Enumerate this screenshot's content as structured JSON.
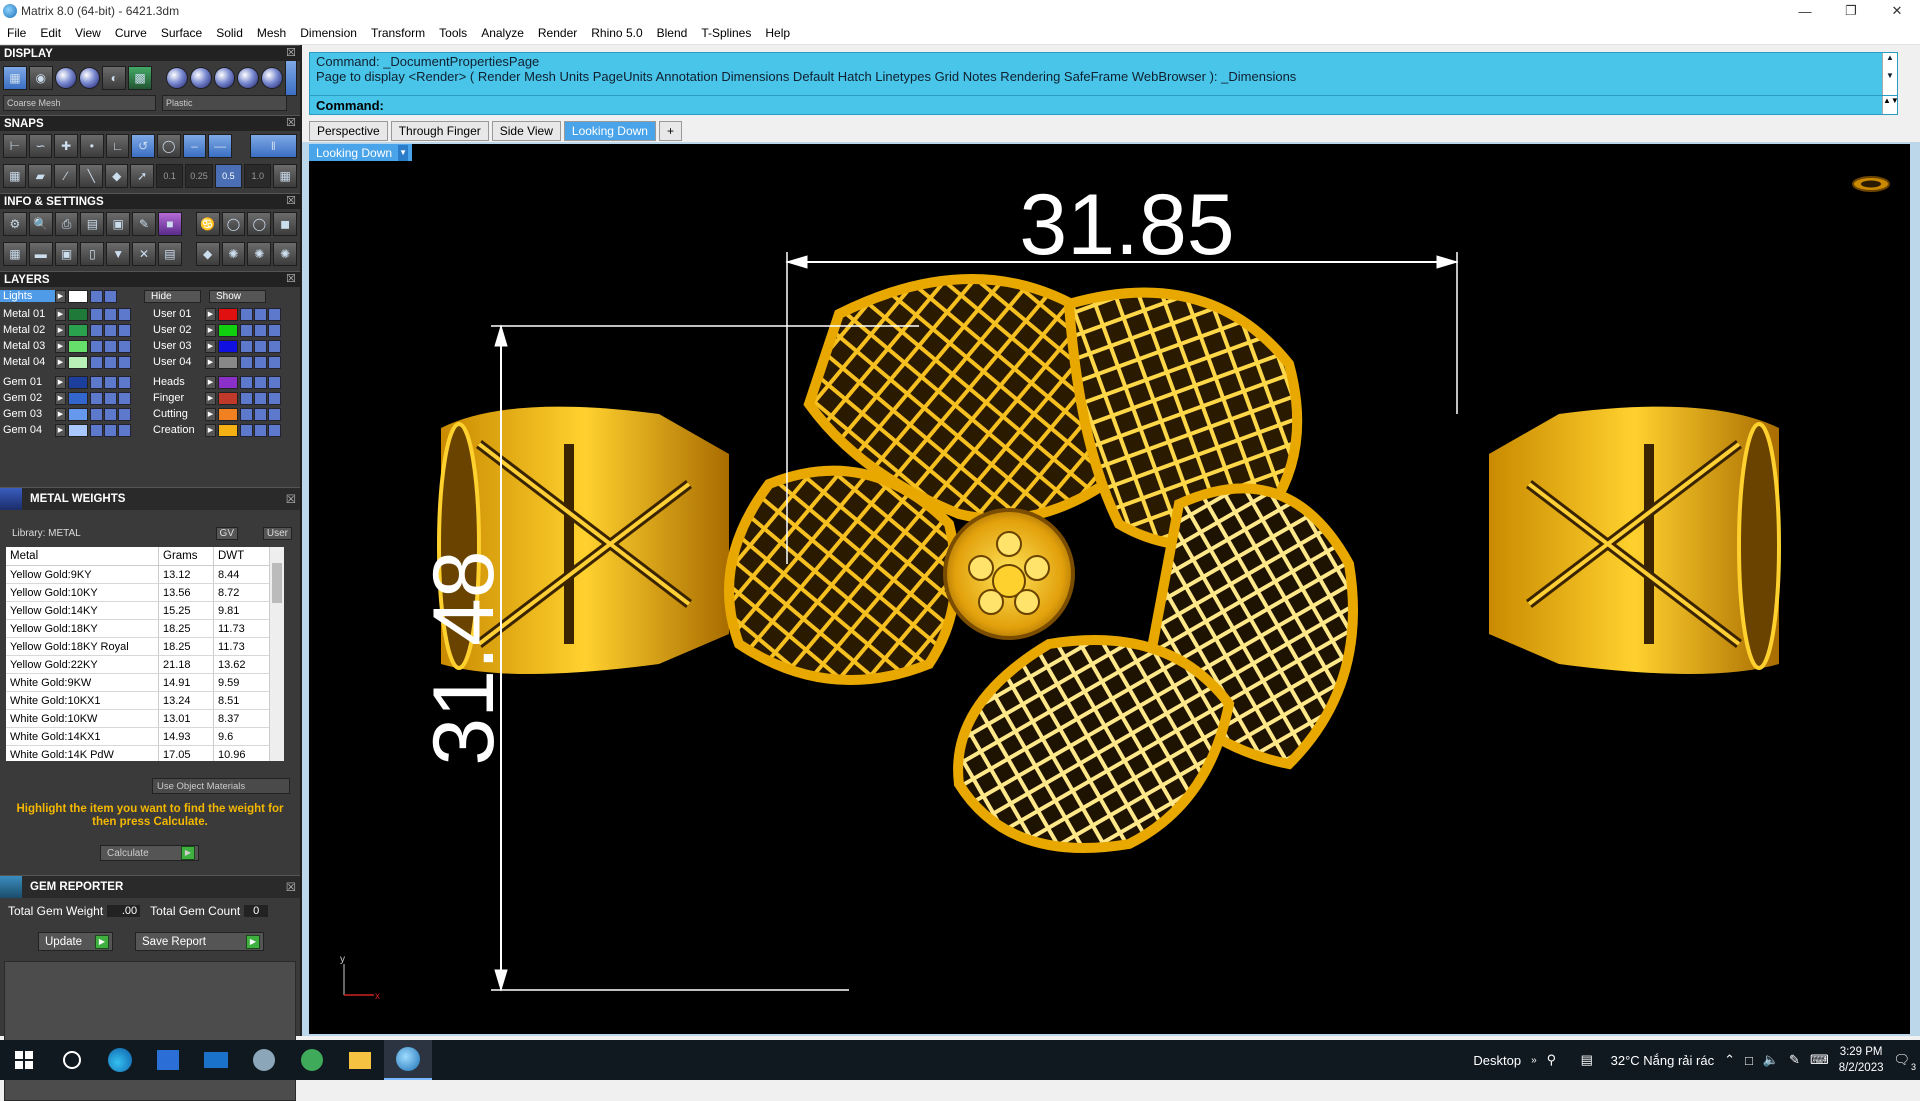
{
  "window": {
    "title": "Matrix 8.0 (64-bit) - 6421.3dm"
  },
  "menu": [
    "File",
    "Edit",
    "View",
    "Curve",
    "Surface",
    "Solid",
    "Mesh",
    "Dimension",
    "Transform",
    "Tools",
    "Analyze",
    "Render",
    "Rhino 5.0",
    "Blend",
    "T-Splines",
    "Help"
  ],
  "panels": {
    "display": {
      "title": "DISPLAY",
      "mesh_dropdown": "Coarse Mesh",
      "material_dropdown": "Plastic"
    },
    "snaps": {
      "title": "SNAPS",
      "values": [
        "0.1",
        "0.25",
        "0.5",
        "1.0"
      ]
    },
    "info": {
      "title": "INFO & SETTINGS"
    },
    "layers": {
      "title": "LAYERS",
      "lights_label": "Lights",
      "hide_label": "Hide",
      "show_label": "Show",
      "left": [
        {
          "name": "Metal 01",
          "color": "#1f7a3a"
        },
        {
          "name": "Metal 02",
          "color": "#2aa14d"
        },
        {
          "name": "Metal 03",
          "color": "#66e06b"
        },
        {
          "name": "Metal 04",
          "color": "#b8f0b8"
        },
        {
          "name": "Gem 01",
          "color": "#1c3f9e"
        },
        {
          "name": "Gem 02",
          "color": "#3366cc"
        },
        {
          "name": "Gem 03",
          "color": "#6699ee"
        },
        {
          "name": "Gem 04",
          "color": "#a9c8ff"
        }
      ],
      "right": [
        {
          "name": "User 01",
          "color": "#e01010"
        },
        {
          "name": "User 02",
          "color": "#10d010"
        },
        {
          "name": "User 03",
          "color": "#1010e0"
        },
        {
          "name": "User 04",
          "color": "#888888"
        },
        {
          "name": "Heads",
          "color": "#8b2fc9"
        },
        {
          "name": "Finger",
          "color": "#c0392b"
        },
        {
          "name": "Cutting",
          "color": "#f08020"
        },
        {
          "name": "Creation",
          "color": "#f5b014"
        }
      ]
    },
    "metal_weights": {
      "title": "METAL WEIGHTS",
      "library": "Library: METAL",
      "gv": "GV",
      "user": "User",
      "columns": [
        "Metal",
        "Grams",
        "DWT"
      ],
      "rows": [
        [
          "Yellow Gold:9KY",
          "13.12",
          "8.44"
        ],
        [
          "Yellow Gold:10KY",
          "13.56",
          "8.72"
        ],
        [
          "Yellow Gold:14KY",
          "15.25",
          "9.81"
        ],
        [
          "Yellow Gold:18KY",
          "18.25",
          "11.73"
        ],
        [
          "Yellow Gold:18KY Royal",
          "18.25",
          "11.73"
        ],
        [
          "Yellow Gold:22KY",
          "21.18",
          "13.62"
        ],
        [
          "White Gold:9KW",
          "14.91",
          "9.59"
        ],
        [
          "White Gold:10KX1",
          "13.24",
          "8.51"
        ],
        [
          "White Gold:10KW",
          "13.01",
          "8.37"
        ],
        [
          "White Gold:14KX1",
          "14.93",
          "9.6"
        ],
        [
          "White Gold:14K PdW",
          "17.05",
          "10.96"
        ]
      ],
      "use_object_materials": "Use Object Materials",
      "hint": "Highlight the item you want to find the weight for then press Calculate.",
      "calculate": "Calculate"
    },
    "gem_reporter": {
      "title": "GEM REPORTER",
      "total_weight_label": "Total Gem Weight",
      "total_weight_value": ".00",
      "total_count_label": "Total Gem Count",
      "total_count_value": "0",
      "update": "Update",
      "save_report": "Save Report"
    }
  },
  "command": {
    "line1": "Command: _DocumentPropertiesPage",
    "line2": "Page to display <Render> ( Render  Mesh  Units  PageUnits  Annotation  Dimensions  Default  Hatch  Linetypes  Grid  Notes  Rendering  SafeFrame  WebBrowser ): _Dimensions",
    "prompt": "Command:"
  },
  "tabs": [
    "Perspective",
    "Through Finger",
    "Side View",
    "Looking Down",
    "+"
  ],
  "viewport": {
    "name": "Looking Down",
    "dim_width": "31.85",
    "dim_height": "31.48",
    "axis_y": "y",
    "axis_x": "x"
  },
  "taskbar": {
    "desktop": "Desktop",
    "weather": "32°C  Nắng rải rác",
    "time": "3:29 PM",
    "date": "8/2/2023",
    "notifications": "3"
  }
}
